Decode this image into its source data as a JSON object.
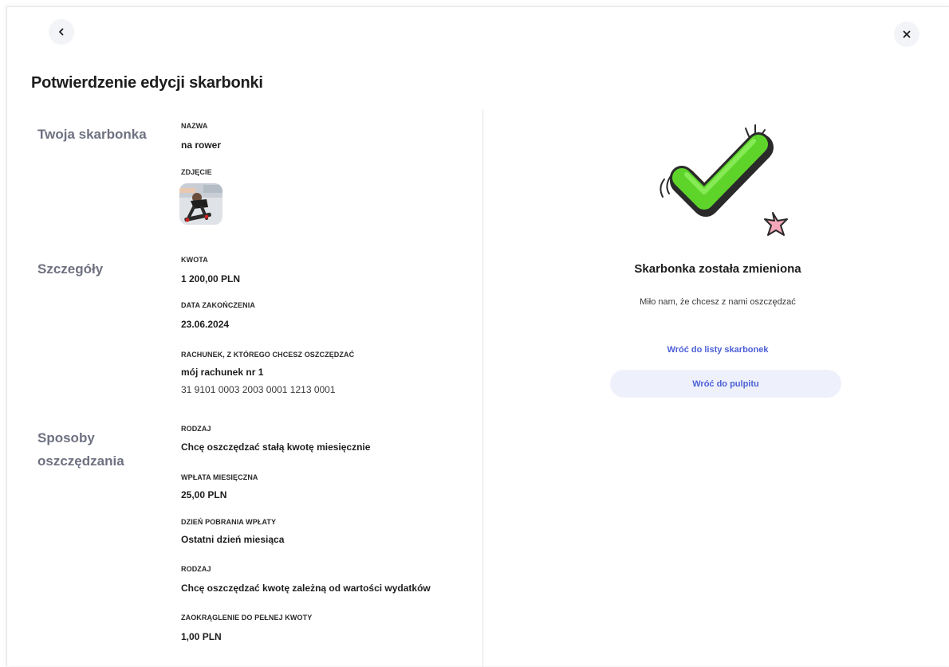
{
  "header": {
    "title": "Potwierdzenie edycji skarbonki"
  },
  "sections": {
    "piggy": {
      "label": "Twoja skarbonka",
      "name_label": "NAZWA",
      "name_value": "na rower",
      "photo_label": "ZDJĘCIE"
    },
    "details": {
      "label": "Szczegóły",
      "amount_label": "KWOTA",
      "amount_value": "1 200,00 PLN",
      "end_date_label": "DATA ZAKOŃCZENIA",
      "end_date_value": "23.06.2024",
      "account_label": "RACHUNEK, Z KTÓREGO CHCESZ OSZCZĘDZAĆ",
      "account_name": "mój rachunek nr 1",
      "account_number": "31 9101 0003 2003 0001 1213 0001"
    },
    "methods": {
      "label_line1": "Sposoby",
      "label_line2": "oszczędzania",
      "type1_label": "RODZAJ",
      "type1_value": "Chcę oszczędzać stałą kwotę miesięcznie",
      "monthly_label": "WPŁATA MIESIĘCZNA",
      "monthly_value": "25,00 PLN",
      "day_label": "DZIEŃ POBRANIA WPŁATY",
      "day_value": "Ostatni dzień miesiąca",
      "type2_label": "RODZAJ",
      "type2_value": "Chcę oszczędzać kwotę zależną od wartości wydatków",
      "rounding_label": "ZAOKRĄGLENIE DO PEŁNEJ KWOTY",
      "rounding_value": "1,00 PLN"
    }
  },
  "success": {
    "title": "Skarbonka została zmieniona",
    "subtitle": "Miło nam, że chcesz z nami oszczędzać",
    "link_label": "Wróć do listy skarbonek",
    "button_label": "Wróć do pulpitu"
  },
  "icons": {
    "back": "chevron-left-icon",
    "close": "close-icon",
    "success": "checkmark-illustration"
  },
  "colors": {
    "accent": "#4b5fd6",
    "check_green": "#5ed42a",
    "section_label": "#6e7180",
    "pill_bg": "#eef1fb"
  }
}
